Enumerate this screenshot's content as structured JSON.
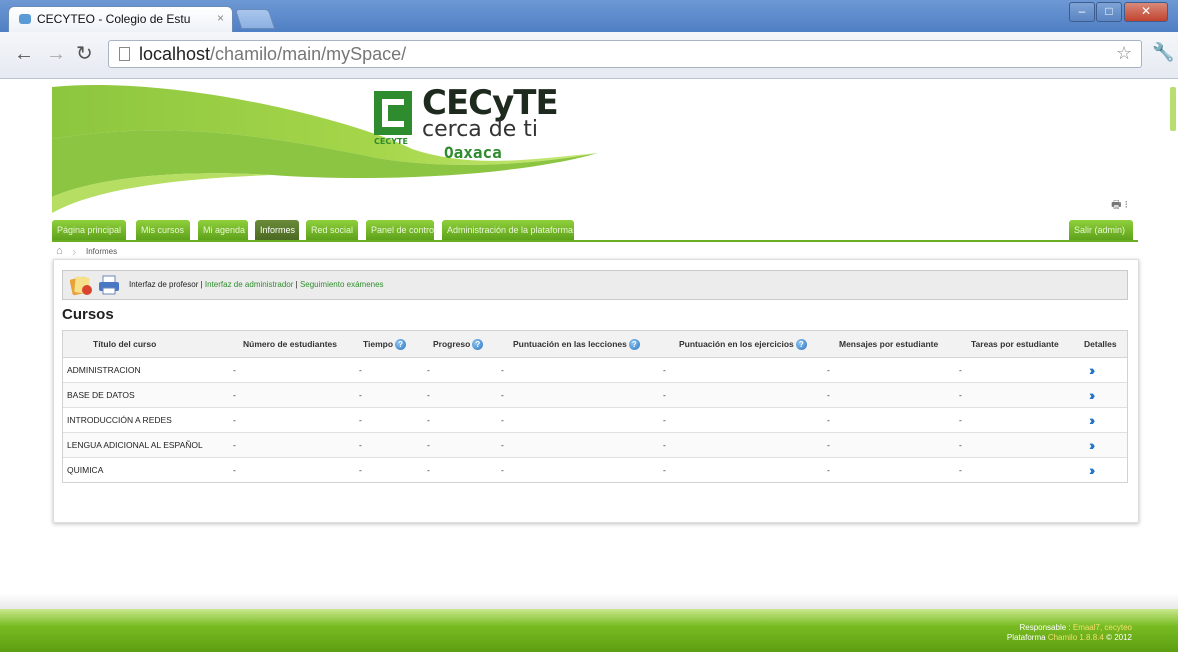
{
  "browser": {
    "tab_title": "CECYTEO - Colegio de Estu",
    "tab_close": "×",
    "url_host": "localhost",
    "url_path": "/chamilo/main/mySpace/"
  },
  "header": {
    "logo_title": "CECyTE",
    "logo_subtitle": "cerca de ti",
    "logo_city": "Oaxaca",
    "logo_small": "CECYTE",
    "print_icon": "printer-icon"
  },
  "nav": {
    "tabs": [
      "Página principal",
      "Mis cursos",
      "Mi agenda",
      "Informes",
      "Red social",
      "Panel de control",
      "Administración de la plataforma"
    ],
    "logout": "Salir (admin)",
    "active_tab": "Informes"
  },
  "breadcrumb": {
    "home_icon": "home-icon",
    "current": "Informes"
  },
  "actions": {
    "teacher_label": "Interfaz de profesor",
    "separator": " | ",
    "admin_link": "Interfaz de administrador",
    "exams_link": "Seguimiento exámenes"
  },
  "courses": {
    "title": "Cursos",
    "headers": [
      "Título del curso",
      "Número de estudiantes",
      "Tiempo",
      "Progreso",
      "Puntuación en las lecciones",
      "Puntuación en los ejercicios",
      "Mensajes por estudiante",
      "Tareas por estudiante",
      "Detalles"
    ],
    "rows": [
      {
        "name": "ADMINISTRACION",
        "students": "-",
        "time": "-",
        "progress": "-",
        "lessons": "-",
        "exercises": "-",
        "messages": "-",
        "tasks": "-"
      },
      {
        "name": "BASE DE DATOS",
        "students": "-",
        "time": "-",
        "progress": "-",
        "lessons": "-",
        "exercises": "-",
        "messages": "-",
        "tasks": "-"
      },
      {
        "name": "INTRODUCCIÓN A REDES",
        "students": "-",
        "time": "-",
        "progress": "-",
        "lessons": "-",
        "exercises": "-",
        "messages": "-",
        "tasks": "-"
      },
      {
        "name": "LENGUA ADICIONAL AL ESPAÑOL",
        "students": "-",
        "time": "-",
        "progress": "-",
        "lessons": "-",
        "exercises": "-",
        "messages": "-",
        "tasks": "-"
      },
      {
        "name": "QUIMICA",
        "students": "-",
        "time": "-",
        "progress": "-",
        "lessons": "-",
        "exercises": "-",
        "messages": "-",
        "tasks": "-"
      }
    ],
    "details_glyph": "»"
  },
  "footer": {
    "responsible_label": "Responsable :",
    "responsible_name": "Emaal7, cecyteo",
    "platform_label": "Plataforma",
    "platform_name": "Chamilo 1.8.8.4",
    "copyright": "© 2012"
  },
  "colors": {
    "nav_green": "#6aae22",
    "link_green": "#2f8f2f",
    "detail_blue": "#1e73c8"
  }
}
